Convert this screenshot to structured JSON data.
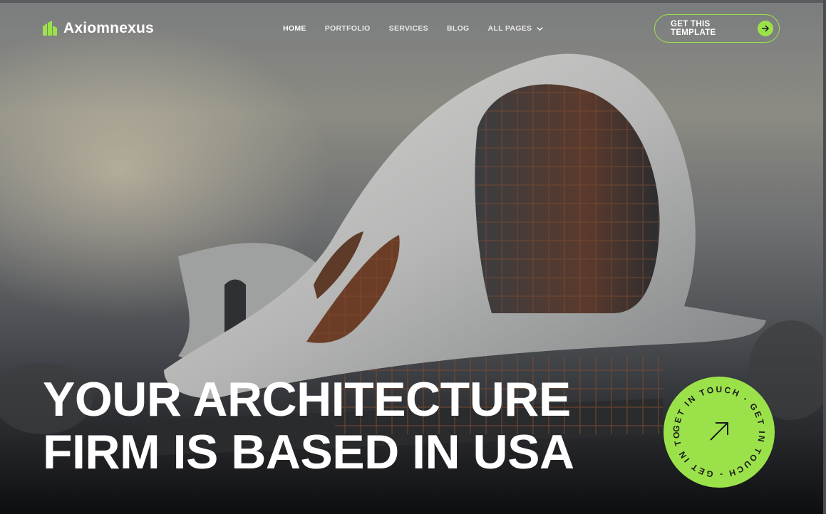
{
  "header": {
    "brand": "Axiomnexus",
    "nav": [
      {
        "label": "HOME",
        "active": true
      },
      {
        "label": "PORTFOLIO"
      },
      {
        "label": "SERVICES"
      },
      {
        "label": "BLOG"
      },
      {
        "label": "ALL PAGES",
        "has_dropdown": true
      }
    ],
    "cta_label": "GET THIS TEMPLATE"
  },
  "hero": {
    "headline_line1": "YOUR ARCHITECTURE",
    "headline_line2": "FIRM IS BASED IN USA"
  },
  "badge": {
    "circular_text": "GET IN TOUCH - GET IN TOUCH - GET IN TOUCH - ",
    "icon": "arrow-up-right-icon"
  },
  "colors": {
    "accent": "#9be24a",
    "text": "#ffffff"
  }
}
